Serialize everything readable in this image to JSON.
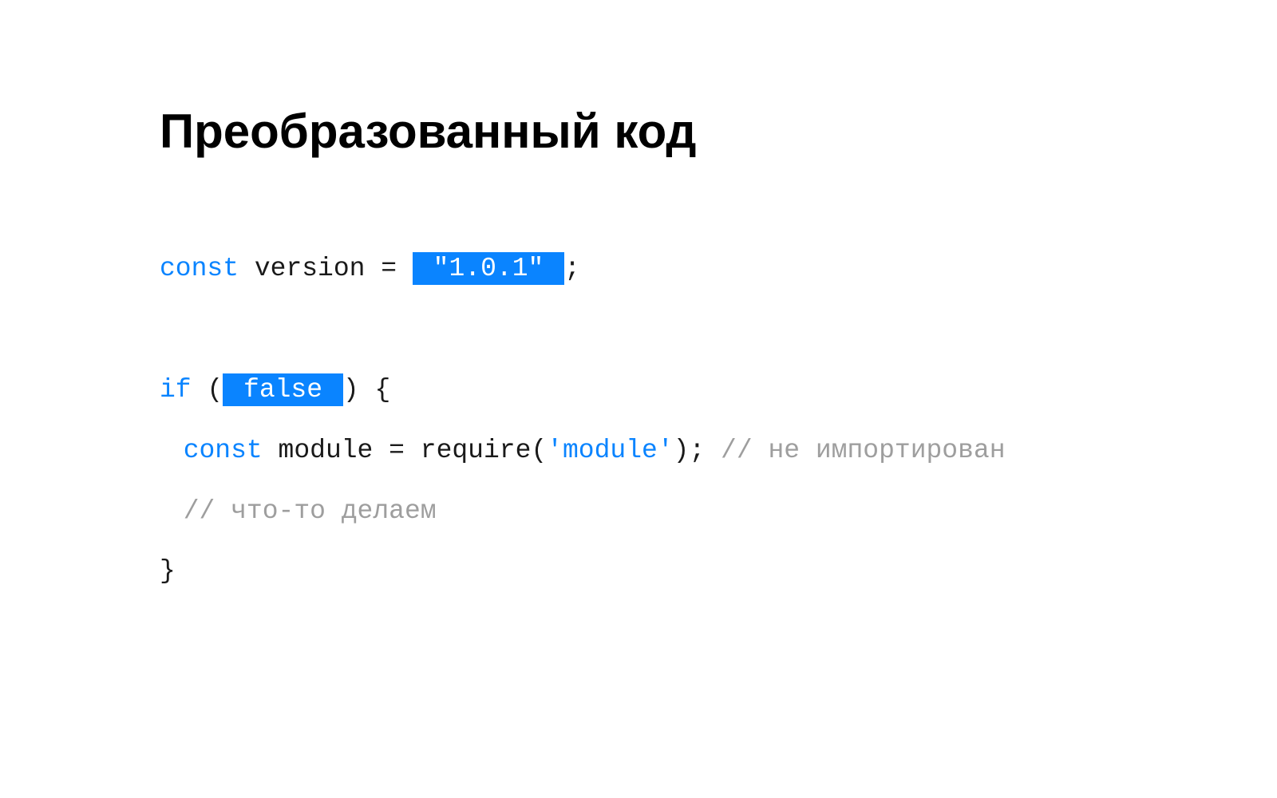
{
  "title": "Преобразованный код",
  "code": {
    "line1": {
      "const": "const",
      "varname": " version ",
      "eq": "= ",
      "value": " \"1.0.1\" ",
      "semi": ";"
    },
    "line2": {
      "if": "if",
      "open": " (",
      "cond": " false ",
      "close": ") {"
    },
    "line3": {
      "const": "const",
      "rest": " module = require(",
      "arg": "'module'",
      "close": ");",
      "comment": " // не импортирован"
    },
    "line4": {
      "comment": "// что-то делаем"
    },
    "line5": {
      "brace": "}"
    }
  }
}
